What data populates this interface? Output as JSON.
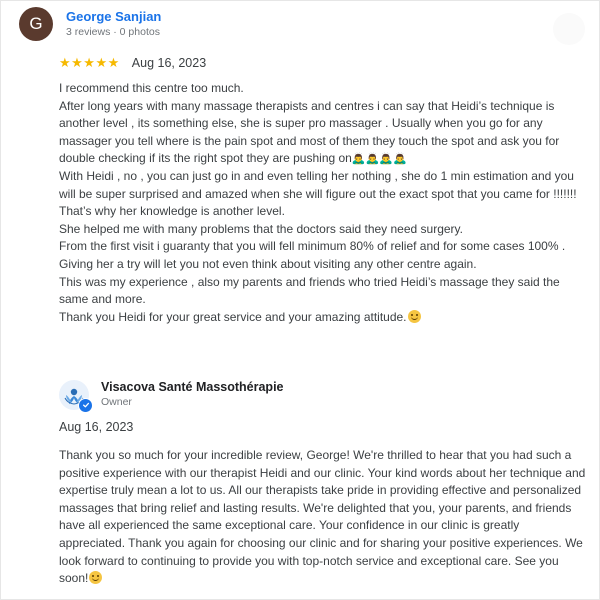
{
  "review": {
    "reviewer": {
      "initial": "G",
      "name": "George Sanjian",
      "stats": "3 reviews · 0 photos",
      "avatar_color": "#5a3a2e",
      "name_color": "#1a73e8"
    },
    "rating": {
      "stars": "★★★★★",
      "value": 5,
      "star_color": "#f6b900"
    },
    "date": "Aug 16, 2023",
    "paragraphs": [
      "I recommend this centre too much.",
      "After long years with many massage therapists and centres i can say that Heidi’s technique is another level , its something else, she is super pro massager . Usually when you go for any massager you tell where is the pain spot and most of them they touch the spot and ask you for double checking if its the right spot they are pushing on",
      "With Heidi , no , you can just go in and even telling her nothing , she do 1 min estimation and you will be super surprised and amazed when she will figure out the exact spot that you came for !!!!!!!",
      "That’s why her knowledge is another level.",
      "She helped me with many problems that the doctors said they need surgery.",
      "From the first visit i guaranty that you will fell minimum 80% of relief and for some cases 100% .",
      "Giving her a try will let you not even think about visiting any other centre again.",
      "This was my experience , also my parents and friends who tried Heidi’s massage they said the same and more.",
      "Thank you Heidi for your great service and your amazing attitude."
    ],
    "emoji_sequence": "🙇‍♂️🙇‍♂️🙇‍♂️🙇‍♂️"
  },
  "owner_reply": {
    "name": "Visacova Santé Massothérapie",
    "role": "Owner",
    "date": "Aug 16, 2023",
    "text": "Thank you so much for your incredible review, George! We're thrilled to hear that you had such a positive experience with our therapist Heidi and our clinic. Your kind words about her technique and expertise truly mean a lot to us. All our therapists take pride in providing effective and personalized massages that bring relief and lasting results. We're delighted that you, your parents, and friends have all experienced the same exceptional care. Your confidence in our clinic is greatly appreciated. Thank you again for choosing our clinic and for sharing your positive experiences. We look forward to continuing to provide you with top-notch service and exceptional care. See you soon!"
  },
  "icons": {
    "avatar": "initial-avatar",
    "menu": "more-options-icon",
    "stars": "star-icon",
    "emoji_bow": "person-bowing-icon",
    "emoji_smile": "smiling-face-icon",
    "owner_logo": "lotus-logo-icon",
    "verified": "verified-check-icon"
  }
}
